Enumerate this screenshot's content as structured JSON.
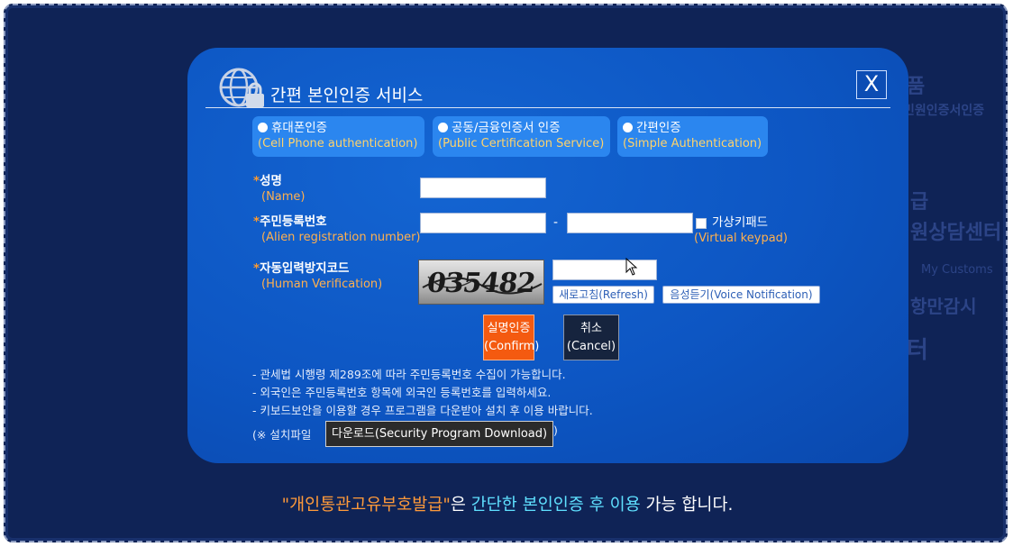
{
  "background": {
    "texts": [
      "품",
      "민원인증서인증",
      "급",
      "원상담센터",
      "My Customs",
      "항만감시",
      "터"
    ]
  },
  "modal": {
    "title": "간편 본인인증 서비스",
    "close_label": "X",
    "tabs": [
      {
        "label": "휴대폰인증",
        "sub": "(Cell Phone authentication)"
      },
      {
        "label": "공동/금융인증서 인증",
        "sub": "(Public Certification Service)"
      },
      {
        "label": "간편인증",
        "sub": "(Simple Authentication)"
      }
    ],
    "fields": {
      "name": {
        "star": "*",
        "label": "성명",
        "sub": "(Name)"
      },
      "alien": {
        "star": "*",
        "label": "주민등록번호",
        "sub": "(Alien registration number)",
        "separator": "-"
      },
      "captcha": {
        "star": "*",
        "label": "자동입력방지코드",
        "sub": "(Human Verification)"
      }
    },
    "virtual_keypad": {
      "label": "가상키패드",
      "sub": "(Virtual keypad)"
    },
    "captcha_code": "035482",
    "refresh_label": "새로고침(Refresh)",
    "voice_label": "음성듣기(Voice Notification)",
    "confirm": {
      "line1": "실명인증",
      "line2": "(Confirm)"
    },
    "cancel": {
      "line1": "취소",
      "line2": "(Cancel)"
    },
    "notes": [
      "- 관세법 시행령 제289조에 따라 주민등록번호 수집이 가능합니다.",
      "- 외국인은 주민등록번호 항목에 외국인 등록번호를 입력하세요.",
      "- 키보드보안을 이용할 경우 프로그램을 다운받아 설치 후 이용 바랍니다."
    ],
    "install_prefix": "(※ 설치파일",
    "download_tooltip": "다운로드(Security Program Download)",
    "install_suffix": ")"
  },
  "footer": {
    "part1": "\"개인통관고유부호발급\"",
    "part2": "은 ",
    "part3": "간단한 본인인증 후 이용",
    "part4": " 가능 합니다."
  },
  "colors": {
    "page_bg": "#0f2356",
    "modal_bg": "#0d56c3",
    "tab_bg": "#2b86ef",
    "accent_orange": "#f45a10",
    "label_orange": "#ffb04e"
  }
}
